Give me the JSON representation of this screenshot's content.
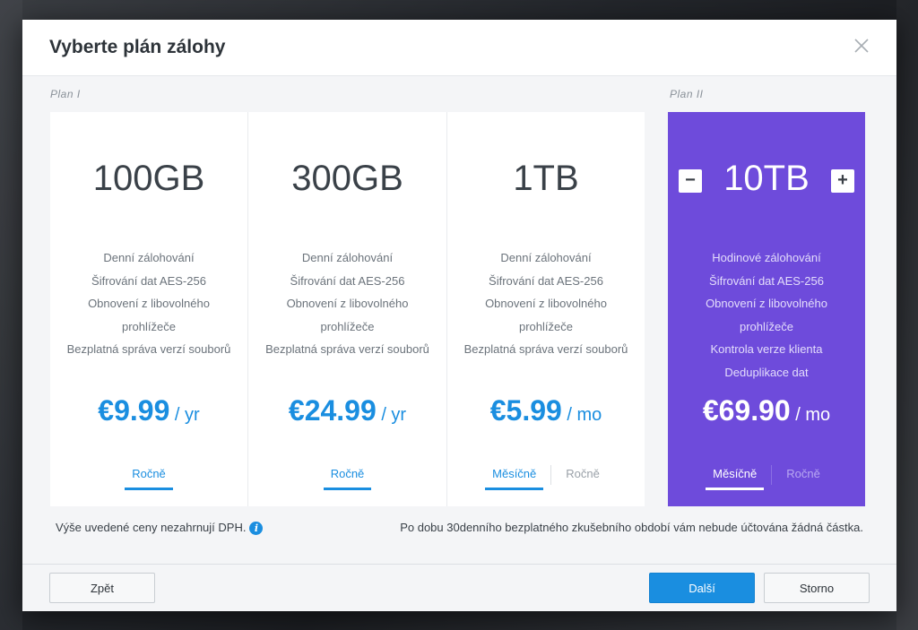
{
  "dialog": {
    "title": "Vyberte plán zálohy",
    "close_icon": "close-icon"
  },
  "plan_groups": [
    {
      "label": "Plan I"
    },
    {
      "label": "Plan II"
    }
  ],
  "cards": [
    {
      "size": "100GB",
      "features": [
        "Denní zálohování",
        "Šifrování dat AES-256",
        "Obnovení z libovolného",
        "prohlížeče",
        "Bezplatná správa verzí souborů"
      ],
      "price_amount": "€9.99",
      "price_unit": " / yr",
      "tabs": [
        {
          "label": "Ročně",
          "active": true
        }
      ]
    },
    {
      "size": "300GB",
      "features": [
        "Denní zálohování",
        "Šifrování dat AES-256",
        "Obnovení z libovolného",
        "prohlížeče",
        "Bezplatná správa verzí souborů"
      ],
      "price_amount": "€24.99",
      "price_unit": " / yr",
      "tabs": [
        {
          "label": "Ročně",
          "active": true
        }
      ]
    },
    {
      "size": "1TB",
      "features": [
        "Denní zálohování",
        "Šifrování dat AES-256",
        "Obnovení z libovolného",
        "prohlížeče",
        "Bezplatná správa verzí souborů"
      ],
      "price_amount": "€5.99",
      "price_unit": " / mo",
      "tabs": [
        {
          "label": "Měsíčně",
          "active": true
        },
        {
          "label": "Ročně",
          "active": false
        }
      ]
    },
    {
      "size": "10TB",
      "features": [
        "Hodinové zálohování",
        "Šifrování dat AES-256",
        "Obnovení z libovolného",
        "prohlížeče",
        "Kontrola verze klienta",
        "Deduplikace dat"
      ],
      "price_amount": "€69.90",
      "price_unit": " / mo",
      "decrement": "−",
      "increment": "+",
      "tabs": [
        {
          "label": "Měsíčně",
          "active": true
        },
        {
          "label": "Ročně",
          "active": false
        }
      ]
    }
  ],
  "footnotes": {
    "vat_note": "Výše uvedené ceny nezahrnují DPH.",
    "info_icon": "i",
    "trial_note": "Po dobu 30denního bezplatného zkušebního období vám nebude účtována žádná částka."
  },
  "footer": {
    "back_label": "Zpět",
    "next_label": "Další",
    "cancel_label": "Storno"
  },
  "colors": {
    "accent": "#1a8ee0",
    "featured": "#6e4bdb"
  }
}
